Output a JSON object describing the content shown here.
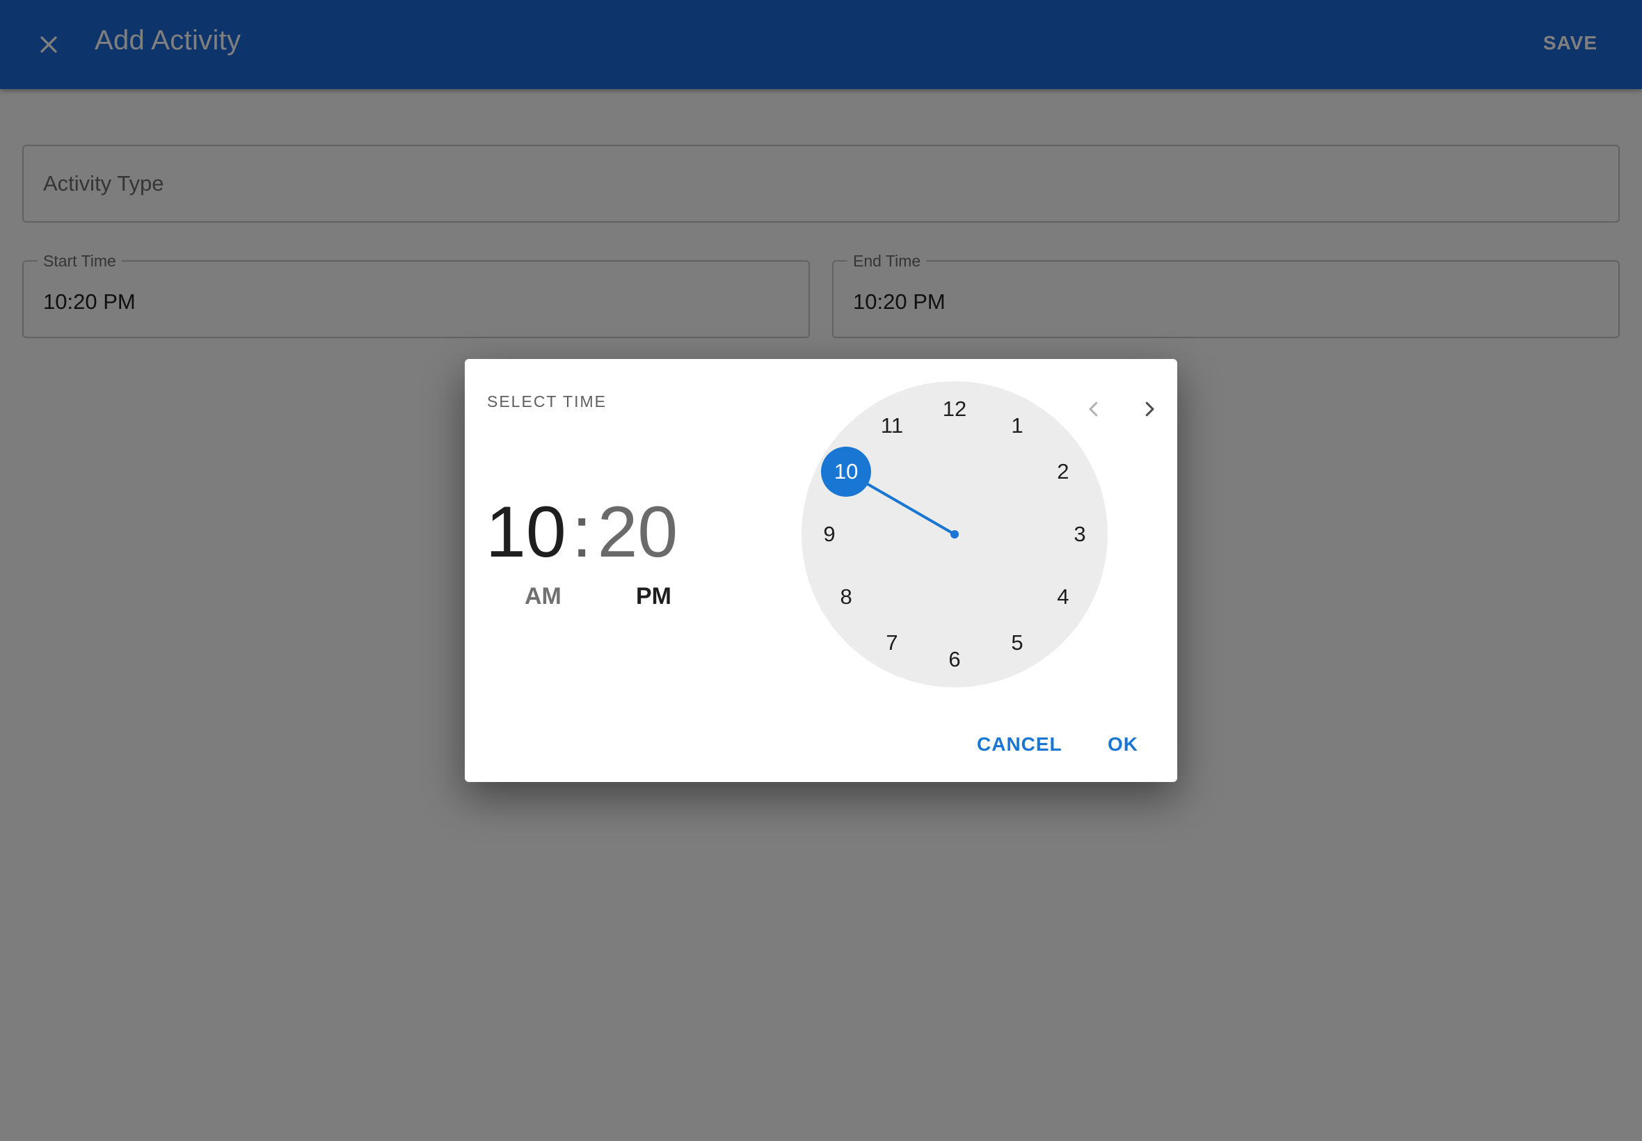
{
  "appbar": {
    "title": "Add Activity",
    "save_label": "SAVE",
    "close_icon": "close-icon"
  },
  "form": {
    "activity_type_placeholder": "Activity Type",
    "start_time": {
      "label": "Start Time",
      "value": "10:20 PM"
    },
    "end_time": {
      "label": "End Time",
      "value": "10:20 PM"
    }
  },
  "dialog": {
    "heading": "SELECT TIME",
    "hour": "10",
    "separator": ":",
    "minute": "20",
    "am_label": "AM",
    "pm_label": "PM",
    "selected_period": "PM",
    "clock_numbers": [
      "12",
      "1",
      "2",
      "3",
      "4",
      "5",
      "6",
      "7",
      "8",
      "9",
      "10",
      "11"
    ],
    "selected_hour": "10",
    "cancel_label": "CANCEL",
    "ok_label": "OK",
    "accent_color": "#1976d2"
  }
}
